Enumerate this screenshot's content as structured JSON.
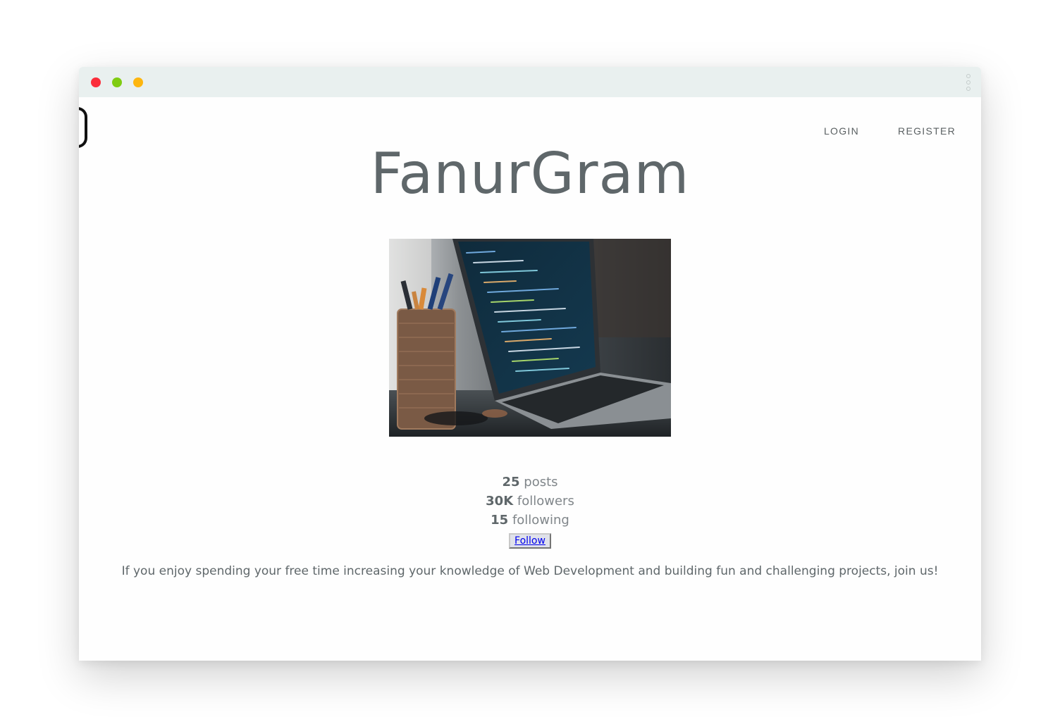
{
  "nav": {
    "login_label": "LOGIN",
    "register_label": "REGISTER"
  },
  "brand": {
    "title": "FanurGram"
  },
  "stats": {
    "posts_count": "25",
    "posts_label": "posts",
    "followers_count": "30K",
    "followers_label": "followers",
    "following_count": "15",
    "following_label": "following"
  },
  "actions": {
    "follow_label": "Follow"
  },
  "tagline": "If you enjoy spending your free time increasing your knowledge of Web Development and building fun and challenging projects, join us!",
  "icons": {
    "window_controls": [
      "close-dot",
      "minimize-dot",
      "zoom-dot"
    ],
    "menu": "kebab-menu-icon"
  },
  "colors": {
    "titlebar": "#e9f0ef",
    "close": "#fb2d3a",
    "minimize": "#7fcc11",
    "zoom": "#fdb60f",
    "text_primary": "#5f676a",
    "link": "#0000ee"
  }
}
